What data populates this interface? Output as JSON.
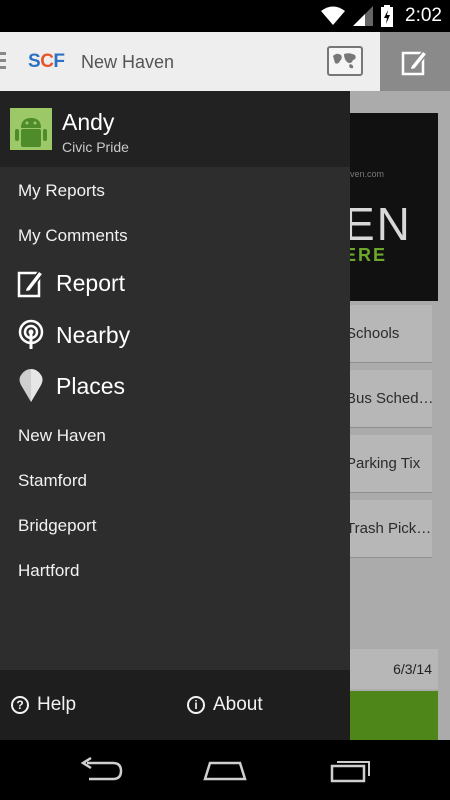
{
  "status_bar": {
    "time": "2:02",
    "icons": [
      "wifi-icon",
      "signal-icon",
      "battery-icon"
    ]
  },
  "action_bar": {
    "logo": {
      "s": "S",
      "c": "C",
      "f": "F"
    },
    "title": "New Haven",
    "map_icon": "map-icon",
    "compose_icon": "compose-icon"
  },
  "content": {
    "banner_url": "ven.com",
    "banner_big": "EN",
    "banner_small": "ERE",
    "tiles": [
      "Schools",
      "Bus Sched…",
      "Parking Tix",
      "Trash Pick…"
    ],
    "card_date": "6/3/14"
  },
  "drawer": {
    "profile": {
      "name": "Andy",
      "subtitle": "Civic Pride"
    },
    "items": [
      {
        "label": "My Reports"
      },
      {
        "label": "My Comments"
      }
    ],
    "big_items": [
      {
        "label": "Report",
        "icon": "report-icon"
      },
      {
        "label": "Nearby",
        "icon": "nearby-icon"
      },
      {
        "label": "Places",
        "icon": "places-icon"
      }
    ],
    "places": [
      {
        "label": "New Haven"
      },
      {
        "label": "Stamford"
      },
      {
        "label": "Bridgeport"
      },
      {
        "label": "Hartford"
      }
    ],
    "footer": {
      "help_label": "Help",
      "help_glyph": "?",
      "about_label": "About",
      "about_glyph": "i"
    }
  },
  "colors": {
    "drawer_bg": "#2d2d2d",
    "accent_green": "#4e8619",
    "logo_blue": "#2b73c2",
    "logo_orange": "#e8572b"
  }
}
